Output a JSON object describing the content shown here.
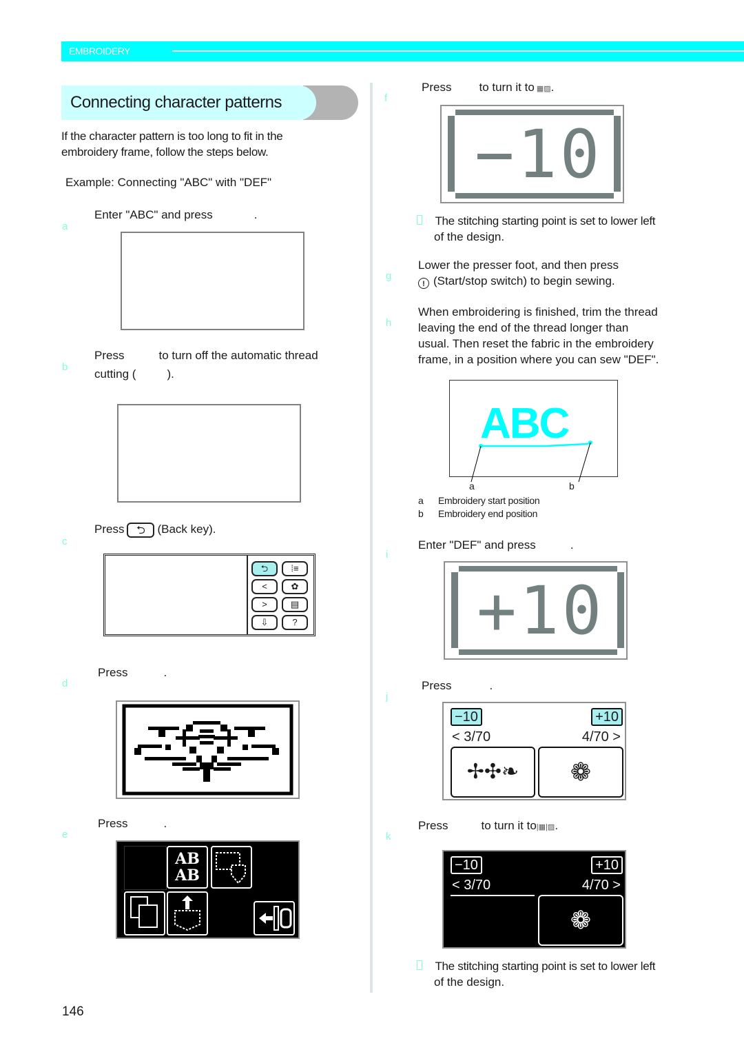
{
  "header": {
    "section_label": "EMBROIDERY",
    "accent_color": "#00ffff"
  },
  "title": "Connecting character patterns",
  "intro": {
    "line1": "If the character pattern is too long to fit in the",
    "line2": "embroidery frame, follow the steps below.",
    "example": "Example: Connecting \"ABC\" with \"DEF\""
  },
  "steps": {
    "a": {
      "letter": "a",
      "text": "Enter \"ABC\" and press",
      "suffix": "."
    },
    "b": {
      "letter": "b",
      "line1_pre": "Press",
      "line1_post": "to turn off the automatic thread",
      "line2_pre": "cutting (",
      "line2_post": ")."
    },
    "c": {
      "letter": "c",
      "pre": "Press",
      "post": "(Back key).",
      "key_icon": "back-arrow"
    },
    "d": {
      "letter": "d",
      "pre": "Press",
      "post": "."
    },
    "e": {
      "letter": "e",
      "pre": "Press",
      "post": "."
    },
    "f": {
      "letter": "f",
      "pre": "Press",
      "post": "to turn it to",
      "end": ".",
      "screen_value": "−10",
      "note": "The stitching starting point is set to lower left",
      "note2": "of the design."
    },
    "g": {
      "letter": "g",
      "line1": "Lower the presser foot, and then press",
      "line2": "(Start/stop switch) to begin sewing."
    },
    "h": {
      "letter": "h",
      "lines": [
        "When embroidering is finished, trim the thread",
        "leaving the end of the thread longer than",
        "usual. Then reset the fabric in the embroidery",
        "frame, in a position where you can sew \"DEF\"."
      ]
    },
    "i": {
      "letter": "i",
      "text": "Enter \"DEF\" and press",
      "suffix": ".",
      "screen_value": "+10"
    },
    "j": {
      "letter": "j",
      "pre": "Press",
      "post": ".",
      "minus_key": "−10",
      "plus_key": "+10",
      "left_page": "< 3/70",
      "right_page": "4/70 >"
    },
    "k": {
      "letter": "k",
      "pre": "Press",
      "post": "to turn it to",
      "end": ".",
      "minus_key": "−10",
      "plus_key": "+10",
      "left_page": "< 3/70",
      "right_page": "4/70 >",
      "note": "The stitching starting point is set to lower left",
      "note2": "of the design."
    }
  },
  "illustration": {
    "text": "ABC",
    "label_a": "a",
    "label_b": "b",
    "legend": [
      {
        "key": "a",
        "text": "Embroidery start position"
      },
      {
        "key": "b",
        "text": "Embroidery end position"
      }
    ]
  },
  "panel_c": {
    "buttons": [
      "back-arrow",
      "thread-tension",
      "left-arrow",
      "embroidery-frame",
      "right-arrow",
      "document",
      "pocket-save",
      "help"
    ]
  },
  "panel_e": {
    "tiles": [
      "blank",
      "AB AB",
      "frame-shape",
      "copy",
      "pocket-upload",
      "exit"
    ]
  },
  "page_number": "146"
}
